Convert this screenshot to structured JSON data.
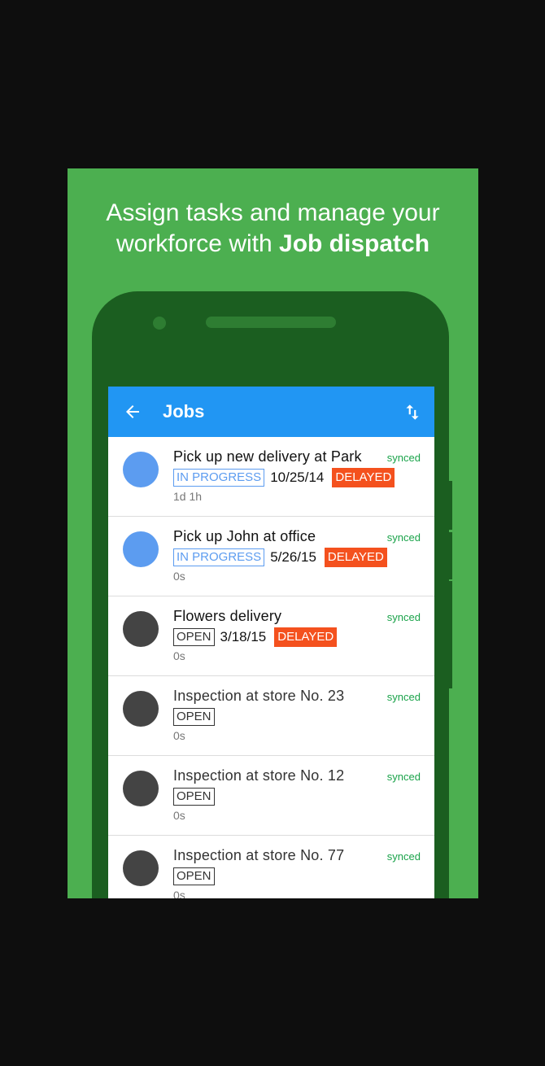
{
  "promo": {
    "headline_line1": "Assign tasks and manage your",
    "headline_line2_prefix": "workforce with ",
    "headline_line2_strong": "Job dispatch",
    "background_color": "#4caf50"
  },
  "appbar": {
    "title": "Jobs",
    "back_icon": "arrow-left-icon",
    "sort_icon": "sort-arrows-icon",
    "color": "#2196f3"
  },
  "jobs": [
    {
      "title": "Pick up new delivery at Park",
      "sync": "synced",
      "status": "IN PROGRESS",
      "date": "10/25/14",
      "flag": "DELAYED",
      "duration": "1d 1h",
      "avatar_color": "#5c9cf0"
    },
    {
      "title": "Pick up John at office",
      "sync": "synced",
      "status": "IN PROGRESS",
      "date": "5/26/15",
      "flag": "DELAYED",
      "duration": "0s",
      "avatar_color": "#5c9cf0"
    },
    {
      "title": "Flowers delivery",
      "sync": "synced",
      "status": "OPEN",
      "date": "3/18/15",
      "flag": "DELAYED",
      "duration": "0s",
      "avatar_color": "#444444"
    },
    {
      "title": "Inspection at store No. 23",
      "sync": "synced",
      "status": "OPEN",
      "date": "",
      "flag": "",
      "duration": "0s",
      "avatar_color": "#444444"
    },
    {
      "title": "Inspection at store No. 12",
      "sync": "synced",
      "status": "OPEN",
      "date": "",
      "flag": "",
      "duration": "0s",
      "avatar_color": "#444444"
    },
    {
      "title": "Inspection at store No. 77",
      "sync": "synced",
      "status": "OPEN",
      "date": "",
      "flag": "",
      "duration": "0s",
      "avatar_color": "#444444"
    }
  ]
}
